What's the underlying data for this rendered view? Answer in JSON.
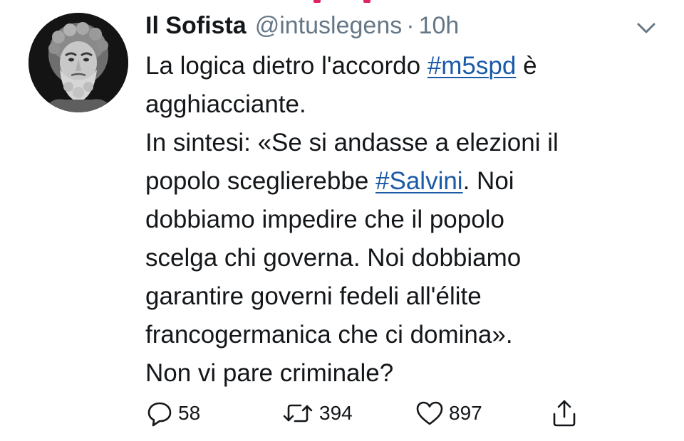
{
  "author": {
    "name": "Il Sofista",
    "handle": "@intuslegens",
    "separator": "·",
    "time": "10h",
    "avatar_icon": "bearded-bust-avatar"
  },
  "tweet": {
    "line1_prefix": "La logica dietro l'accordo ",
    "hashtag1": "#m5spd",
    "line1_suffix": " è",
    "line2": "agghiacciante.",
    "line3": "In sintesi: «Se si andasse a elezioni il",
    "line4_prefix": "popolo sceglierebbe ",
    "hashtag2": "#Salvini",
    "line4_suffix": ". Noi",
    "line5": "dobbiamo impedire che il popolo",
    "line6": "scelga chi governa. Noi dobbiamo",
    "line7": "garantire governi fedeli all'élite",
    "line8": "francogermanica che ci domina».",
    "line9": "Non vi pare criminale?"
  },
  "actions": {
    "reply_count": "58",
    "retweet_count": "394",
    "like_count": "897",
    "reply_icon": "reply-icon",
    "retweet_icon": "retweet-icon",
    "like_icon": "heart-icon",
    "share_icon": "share-icon",
    "menu_icon": "chevron-down-icon"
  },
  "colors": {
    "text": "#14171a",
    "secondary": "#657786",
    "link": "#1b5aa6",
    "accent_top": "#e0245e"
  }
}
